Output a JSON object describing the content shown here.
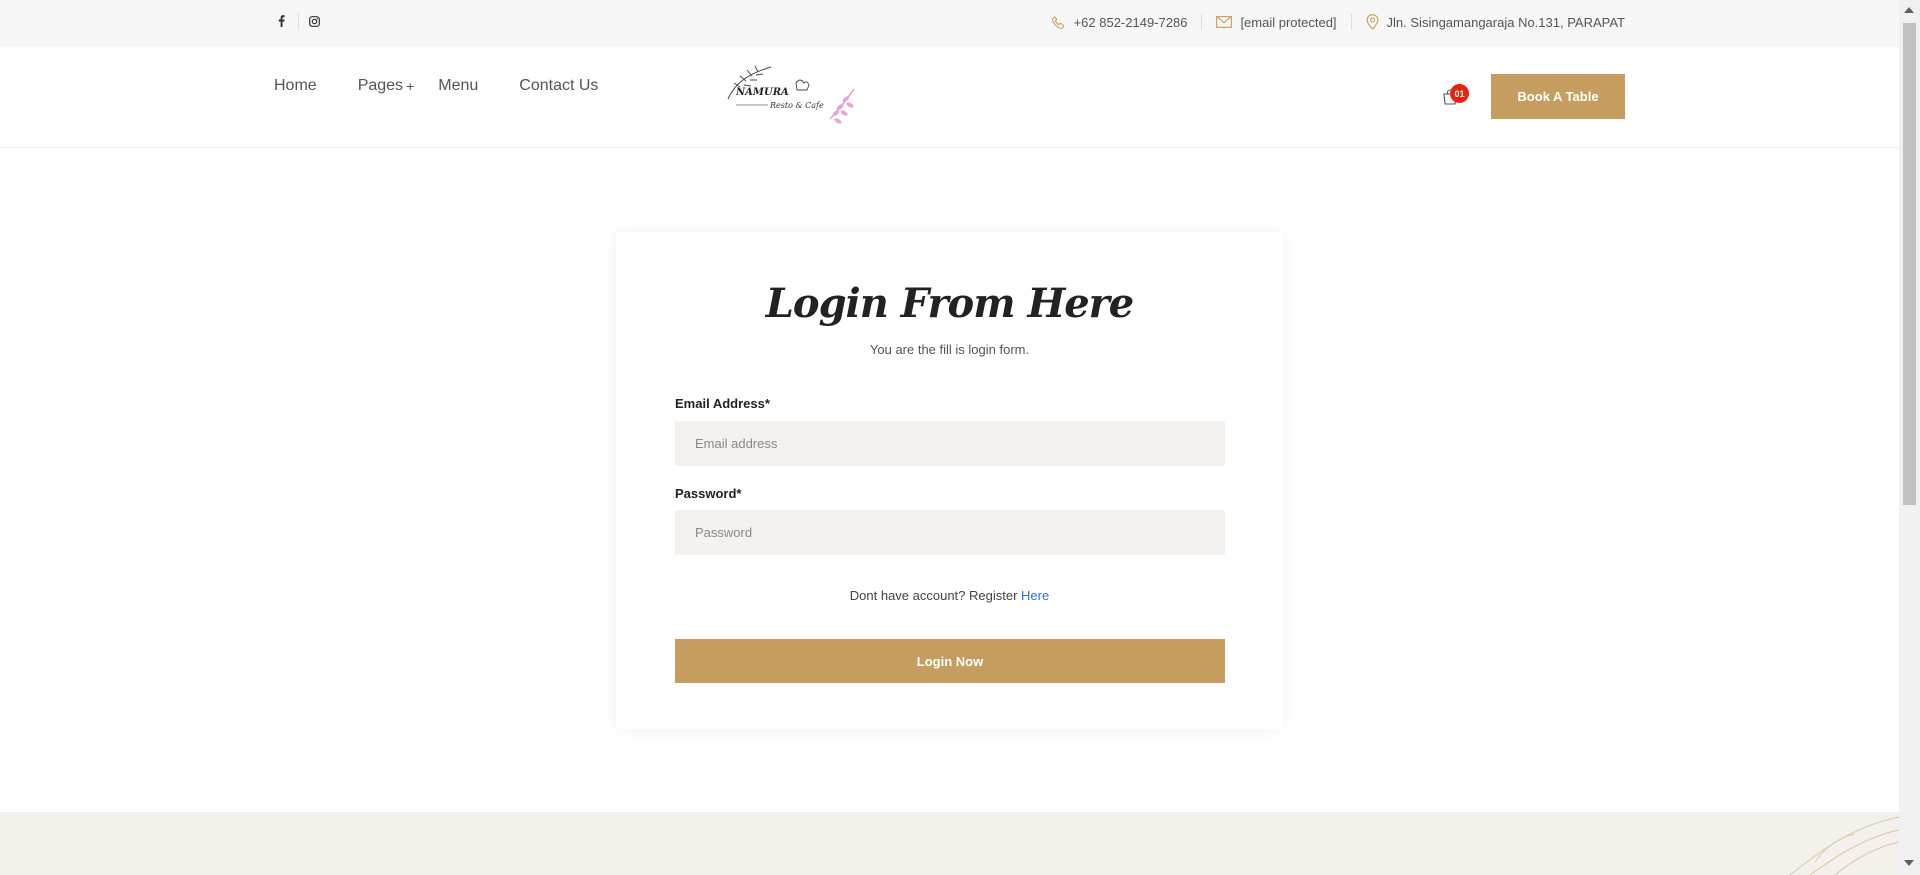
{
  "topbar": {
    "social": [
      "facebook-icon",
      "instagram-icon"
    ],
    "phone": "+62 852-2149-7286",
    "email": "[email protected]",
    "address": "Jln. Sisingamangaraja No.131, PARAPAT"
  },
  "nav": {
    "home": "Home",
    "pages": "Pages",
    "pages_plus": "+",
    "menu": "Menu",
    "contact": "Contact Us"
  },
  "logo": {
    "name": "NAMURA",
    "tagline": "Resto & Cafe"
  },
  "cart": {
    "count": "01"
  },
  "book_button": "Book A Table",
  "login": {
    "title": "Login From Here",
    "subtitle": "You are the fill is login form.",
    "email_label": "Email Address*",
    "email_placeholder": "Email address",
    "password_label": "Password*",
    "password_placeholder": "Password",
    "register_text": "Dont have account? Register ",
    "register_link": "Here",
    "submit": "Login Now"
  },
  "colors": {
    "accent": "#c59d5f",
    "badge": "#e8220d",
    "link": "#2f6fd6",
    "input_bg": "#f4f1ee"
  }
}
